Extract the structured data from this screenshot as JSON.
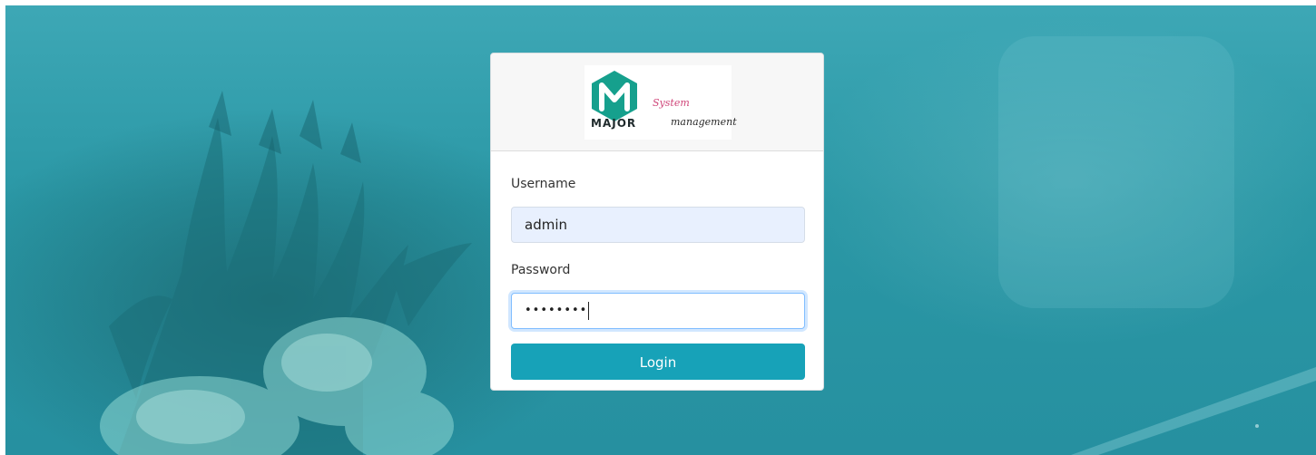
{
  "brand": {
    "logo_major": "MAJOR",
    "logo_system": "System",
    "logo_management": "management",
    "logo_color": "#16a08d",
    "accent": "#17a2b8"
  },
  "form": {
    "username_label": "Username",
    "username_value": "admin",
    "password_label": "Password",
    "password_value": "••••••••",
    "login_label": "Login"
  },
  "icons": {
    "logo_mark": "m-hexagon-logo"
  }
}
